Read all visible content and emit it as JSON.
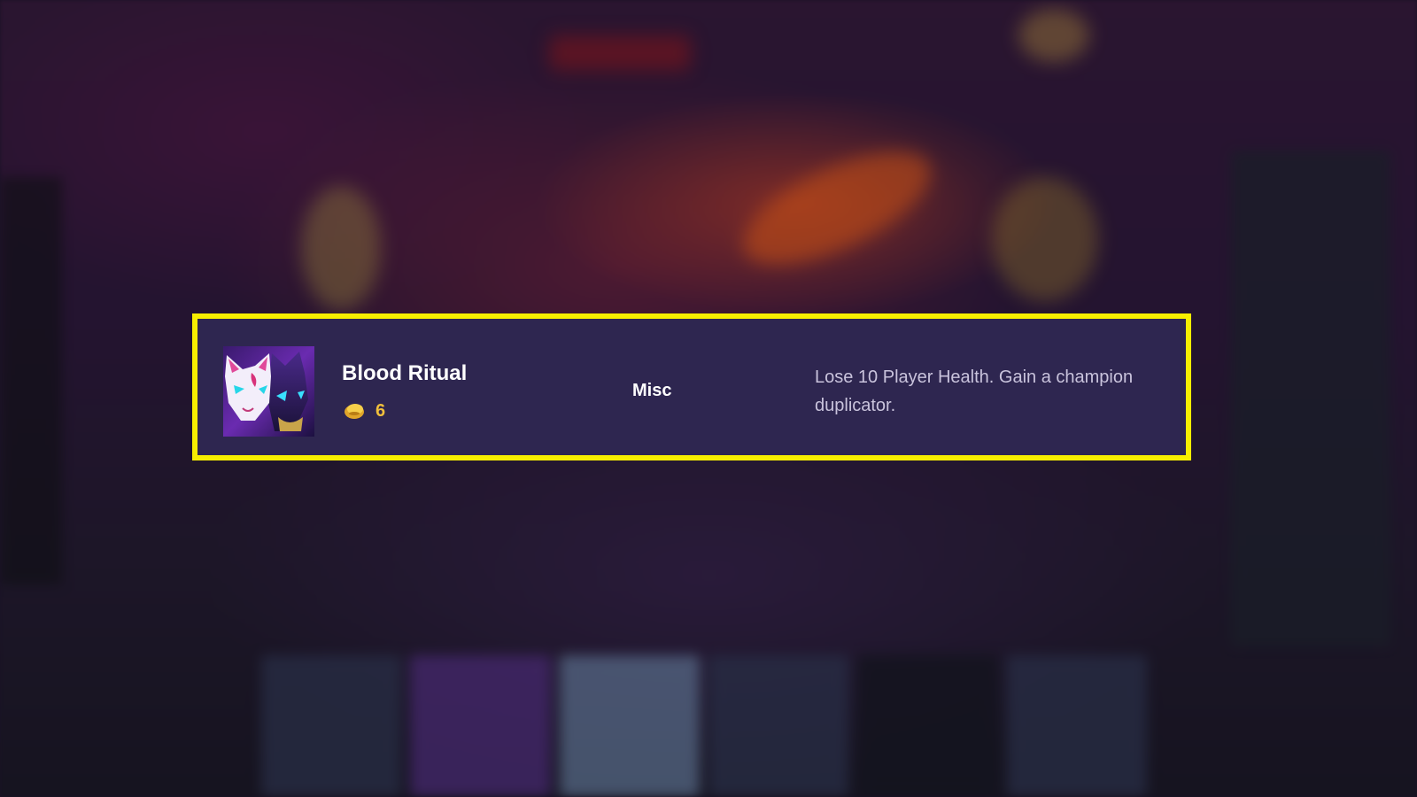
{
  "augment": {
    "name": "Blood Ritual",
    "icon": "kitsune-mask-icon",
    "cost": "6",
    "cost_icon": "gold-coin-icon",
    "category": "Misc",
    "description": "Lose 10 Player Health. Gain a champion duplicator."
  },
  "colors": {
    "highlight_border": "#f7ee00",
    "card_background": "#2e2650",
    "cost_text": "#f0bf3c",
    "description_text": "#c9c3dc"
  }
}
